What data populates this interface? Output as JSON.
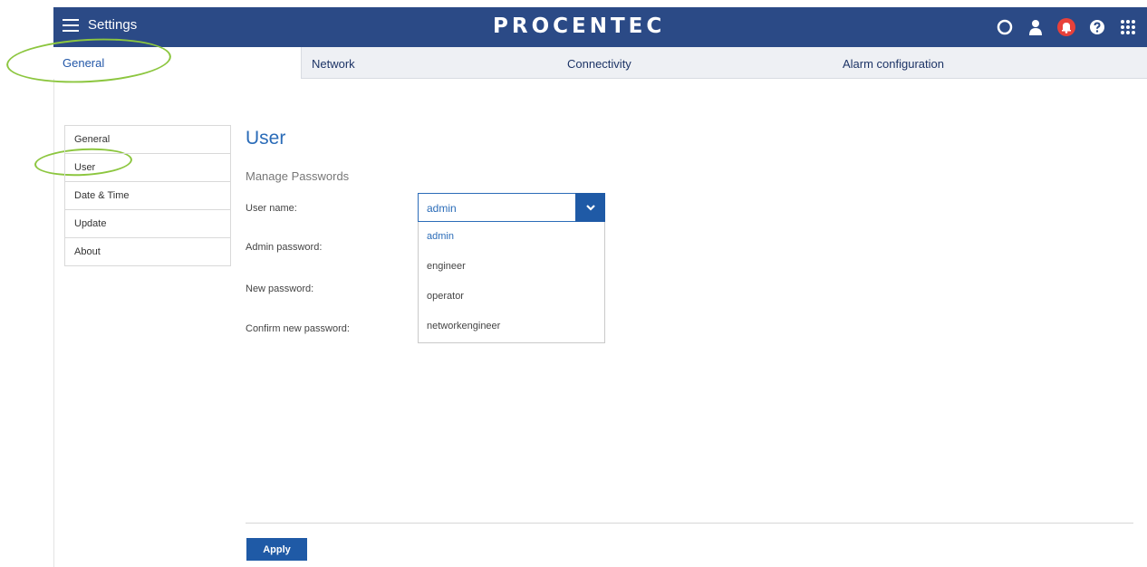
{
  "header": {
    "title": "Settings",
    "brand": "PROCENTEC",
    "icons": [
      "refresh-icon",
      "user-icon",
      "alarm-bell-icon",
      "help-icon",
      "apps-grid-icon"
    ],
    "brand_color": "#2b4a86",
    "alarm_color": "#e8413a"
  },
  "tabs": {
    "general": "General",
    "network": "Network",
    "connectivity": "Connectivity",
    "alarm": "Alarm configuration"
  },
  "sidebar": {
    "items": [
      {
        "label": "General"
      },
      {
        "label": "User"
      },
      {
        "label": "Date & Time"
      },
      {
        "label": "Update"
      },
      {
        "label": "About"
      }
    ]
  },
  "main": {
    "title": "User",
    "section": "Manage Passwords",
    "labels": {
      "username": "User name:",
      "admin_password": "Admin password:",
      "new_password": "New password:",
      "confirm_password": "Confirm new password:"
    },
    "username_select": {
      "value": "admin",
      "options": [
        "admin",
        "engineer",
        "operator",
        "networkengineer"
      ]
    },
    "apply_label": "Apply"
  },
  "annotation_color": "#8cc63f"
}
